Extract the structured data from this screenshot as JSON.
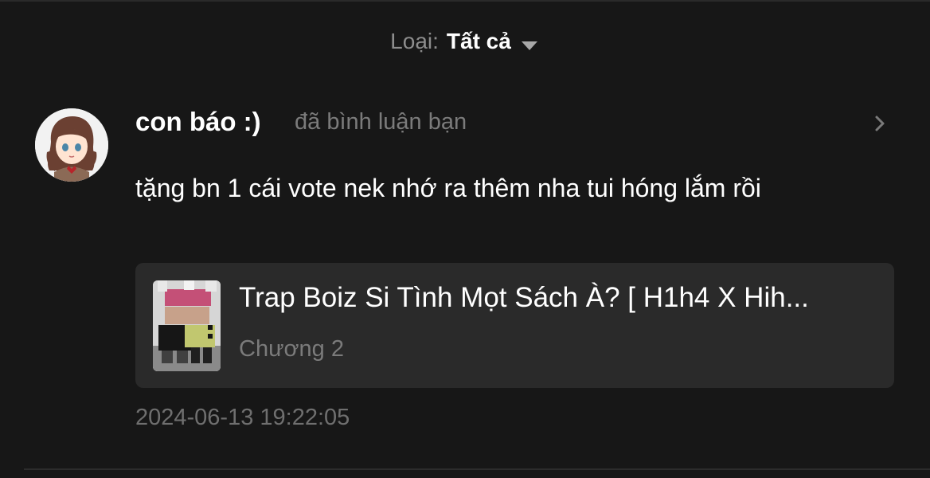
{
  "filter": {
    "label": "Loại:",
    "value": "Tất cả",
    "caret_icon": "caret-down-icon"
  },
  "notification": {
    "avatar_icon": "user-avatar",
    "username": "con báo :)",
    "action": "đã bình luận bạn",
    "chevron_icon": "chevron-right-icon",
    "comment": "tặng bn 1 cái vote nek nhớ ra thêm nha tui hóng lắm rồi",
    "story": {
      "cover_icon": "story-cover-image",
      "title": "Trap Boiz Si Tình Mọt Sách À? [ H1h4 X Hih...",
      "chapter": "Chương 2"
    },
    "timestamp": "2024-06-13 19:22:05"
  },
  "colors": {
    "background": "#171717",
    "card": "#2a2a2a",
    "primary_text": "#ffffff",
    "secondary_text": "#7b7b7b"
  }
}
